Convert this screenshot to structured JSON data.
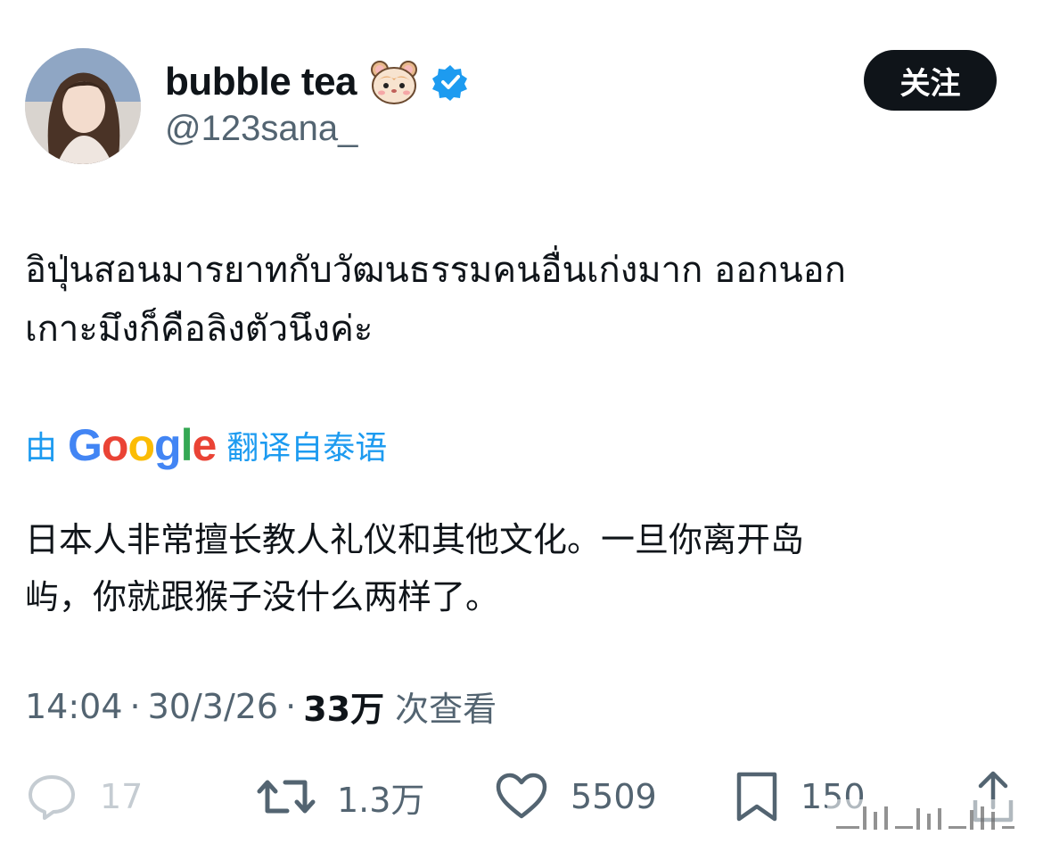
{
  "user": {
    "display_name": "bubble tea",
    "emoji_icon": "hamster-face-icon",
    "verified_icon": "verified-badge-icon",
    "handle": "@123sana_"
  },
  "follow_label": "关注",
  "tweet": {
    "lines": [
      "อิปุ่นสอนมารยาทกับวัฒนธรรมคนอื่นเก่งมาก ออกนอก",
      "เกาะมึงก็คือลิงตัวนึงค่ะ"
    ]
  },
  "translation": {
    "prefix": "由",
    "brand": "Google",
    "suffix": "翻译自泰语",
    "lines": [
      "日本人非常擅长教人礼仪和其他文化。一旦你离开岛",
      "屿，你就跟猴子没什么两样了。"
    ]
  },
  "meta": {
    "time": "14:04",
    "date": "30/3/26",
    "views_count": "33万",
    "views_label": "次查看"
  },
  "actions": {
    "reply": {
      "icon": "reply-icon",
      "count": "17"
    },
    "retweet": {
      "icon": "retweet-icon",
      "count": "1.3万"
    },
    "like": {
      "icon": "heart-icon",
      "count": "5509"
    },
    "bookmark": {
      "icon": "bookmark-icon",
      "count": "150"
    },
    "share": {
      "icon": "share-icon"
    }
  },
  "colors": {
    "link_blue": "#1d9bf0",
    "secondary_text": "#536471",
    "primary_text": "#0f1419",
    "follow_button_bg": "#0f1419"
  }
}
